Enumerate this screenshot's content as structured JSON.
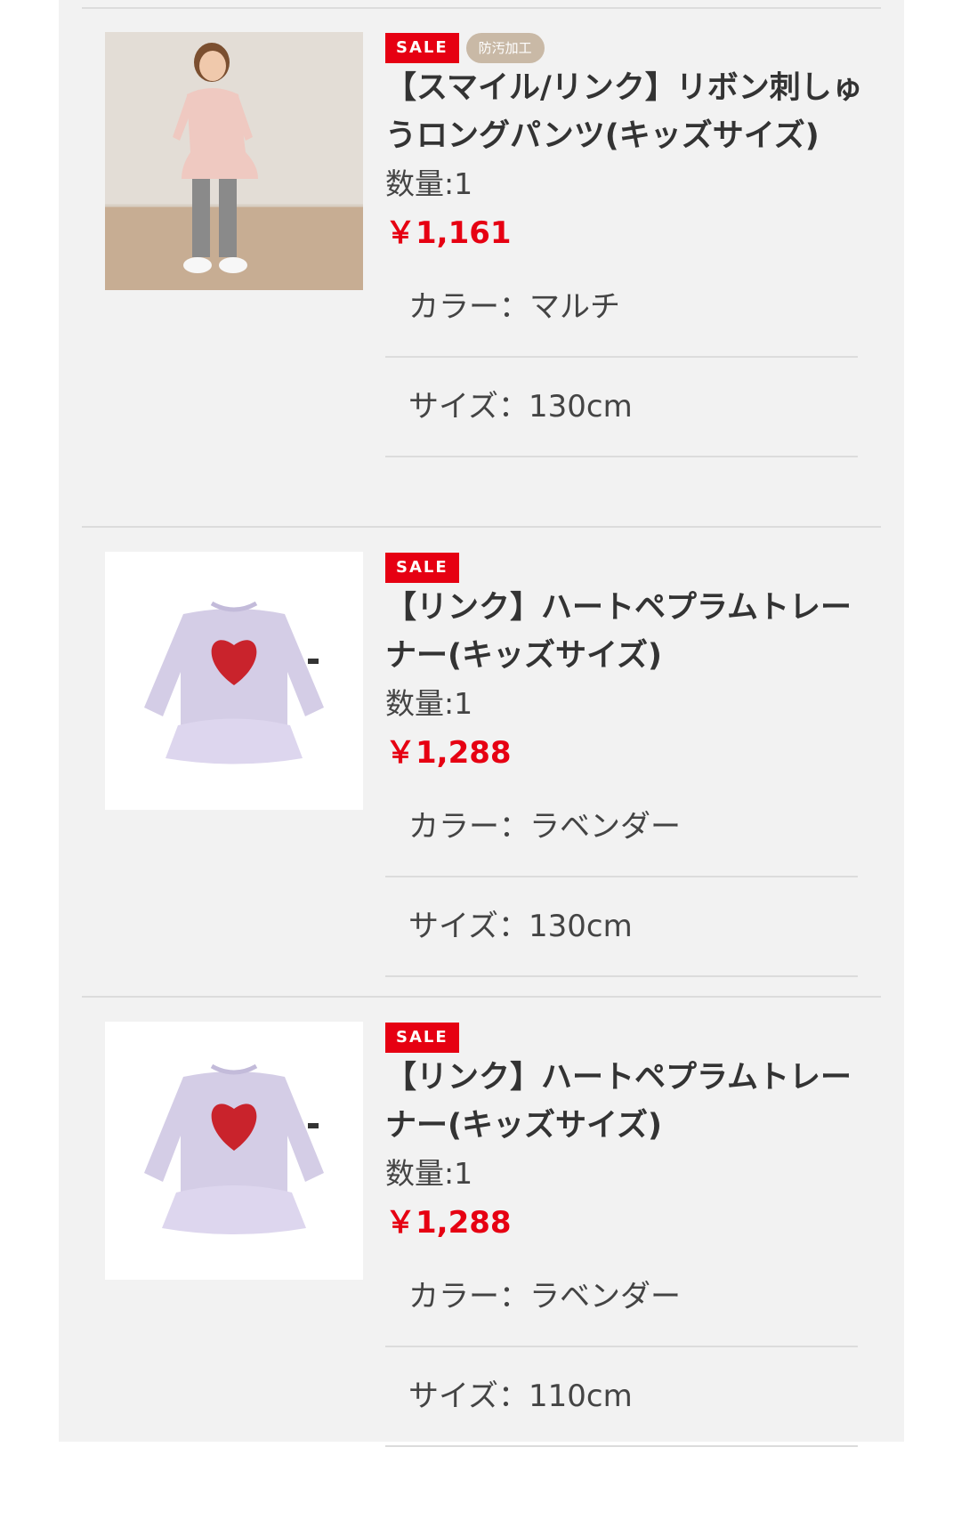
{
  "items": [
    {
      "badges": {
        "sale": "SALE",
        "tag": "防汚加工"
      },
      "title": "【スマイル/リンク】リボン刺しゅうロングパンツ(キッズサイズ)",
      "qty": "数量:1",
      "price": "￥1,161",
      "color": "カラー：マルチ",
      "size": "サイズ：130cm"
    },
    {
      "badges": {
        "sale": "SALE"
      },
      "title": "【リンク】ハートペプラムトレーナー(キッズサイズ)",
      "qty": "数量:1",
      "price": "￥1,288",
      "color": "カラー：ラベンダー",
      "size": "サイズ：130cm"
    },
    {
      "badges": {
        "sale": "SALE"
      },
      "title": "【リンク】ハートペプラムトレーナー(キッズサイズ)",
      "qty": "数量:1",
      "price": "￥1,288",
      "color": "カラー：ラベンダー",
      "size": "サイズ：110cm"
    }
  ],
  "colors": {
    "sale_red": "#e60012",
    "tag_beige": "#c9b9a6",
    "panel_bg": "#f2f2f2"
  }
}
